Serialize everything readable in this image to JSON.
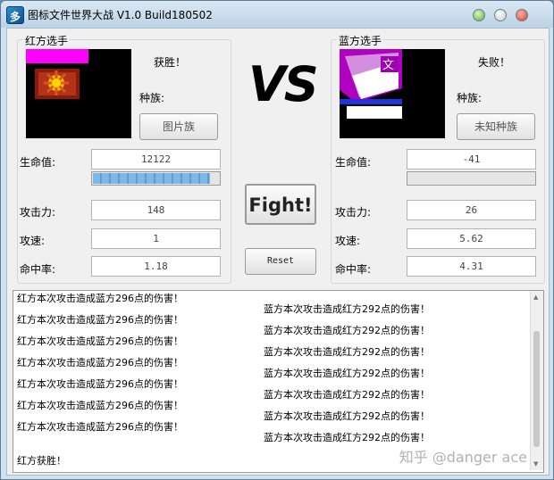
{
  "window": {
    "title": "图标文件世界大战 V1.0 Build180502",
    "icon": "app-icon"
  },
  "red": {
    "group_title": "红方选手",
    "result": "获胜！",
    "race_label": "种族:",
    "race": "图片族",
    "hp_label": "生命值:",
    "hp": "12122",
    "hp_fraction": 0.93,
    "attack_label": "攻击力:",
    "attack": "148",
    "speed_label": "攻速:",
    "speed": "1",
    "hit_label": "命中率:",
    "hit": "1.18"
  },
  "blue": {
    "group_title": "蓝方选手",
    "result": "失败！",
    "race_label": "种族:",
    "race": "未知种族",
    "hp_label": "生命值:",
    "hp": "-41",
    "hp_fraction": 0.0,
    "attack_label": "攻击力:",
    "attack": "26",
    "speed_label": "攻速:",
    "speed": "5.62",
    "hit_label": "命中率:",
    "hit": "4.31"
  },
  "center": {
    "vs": "VS",
    "fight_label": "Fight!",
    "reset_label": "Reset"
  },
  "log": {
    "left_lines": [
      "红方本次攻击造成蓝方296点的伤害！",
      "红方本次攻击造成蓝方296点的伤害！",
      "红方本次攻击造成蓝方296点的伤害！",
      "红方本次攻击造成蓝方296点的伤害！",
      "红方本次攻击造成蓝方296点的伤害！",
      "红方本次攻击造成蓝方296点的伤害！",
      "红方本次攻击造成蓝方296点的伤害！"
    ],
    "right_lines": [
      "蓝方本次攻击造成红方292点的伤害！",
      "蓝方本次攻击造成红方292点的伤害！",
      "蓝方本次攻击造成红方292点的伤害！",
      "蓝方本次攻击造成红方292点的伤害！",
      "蓝方本次攻击造成红方292点的伤害！",
      "蓝方本次攻击造成红方292点的伤害！",
      "蓝方本次攻击造成红方292点的伤害！"
    ],
    "final": "红方获胜！"
  },
  "watermark": "知乎 @danger ace",
  "colors": {
    "progress_fill": "#5d9bd7",
    "red_avatar_accent": "#ff00ff",
    "blue_avatar_accent": "#b000c0"
  }
}
